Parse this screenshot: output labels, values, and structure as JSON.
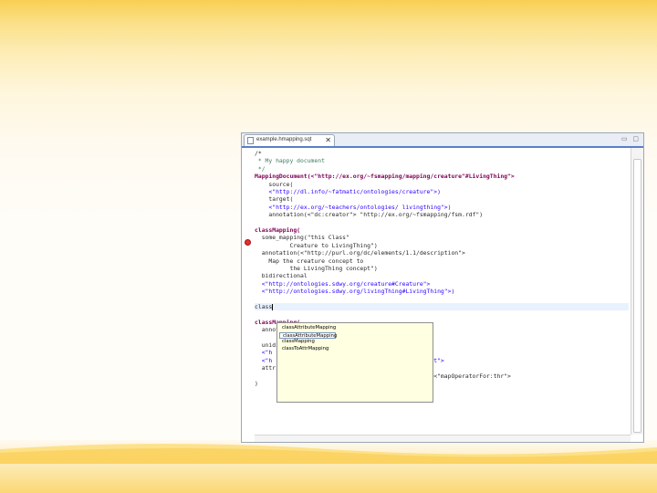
{
  "editor": {
    "tab_title": "example.hmapping.sqt",
    "close_glyph": "✕",
    "window_buttons": "▭ ▢"
  },
  "code_lines": [
    {
      "text": "/*",
      "cls": ""
    },
    {
      "text": " * My happy document",
      "cls": "cm"
    },
    {
      "text": " */",
      "cls": "cm"
    },
    {
      "text": "MappingDocument(<\"http://ex.org/~fsmapping/mapping/creature\"#LivingThing\">",
      "cls": "kw"
    },
    {
      "text": "    source(",
      "cls": ""
    },
    {
      "text": "    <\"http://dl.info/~fatmatic/ontologies/creature\">)",
      "cls": "str"
    },
    {
      "text": "    target(",
      "cls": ""
    },
    {
      "text": "    <\"http://ex.org/~teachers/ontologies/ livingthing\">)",
      "cls": "str"
    },
    {
      "text": "    annotation(<\"dc:creator\"> \"http://ex.org/~fsmapping/fsm.rdf\")",
      "cls": ""
    },
    {
      "text": "",
      "cls": ""
    },
    {
      "text": "classMapping(",
      "cls": "kw"
    },
    {
      "text": "  some_mapping(\"this Class\"",
      "cls": ""
    },
    {
      "text": "          Creature to LivingThing\")",
      "cls": ""
    },
    {
      "text": "  annotation(<\"http://purl.org/dc/elements/1.1/description\">",
      "cls": ""
    },
    {
      "text": "    Map the creature concept to",
      "cls": ""
    },
    {
      "text": "          the LivingThing concept\")",
      "cls": ""
    },
    {
      "text": "  bidirectional",
      "cls": ""
    },
    {
      "text": "  <\"http://ontologies.sdwy.org/creature#Creature\">",
      "cls": "str"
    },
    {
      "text": "  <\"http://ontologies.sdwy.org/livingThing#LivingThing\">)",
      "cls": "str"
    },
    {
      "text": "",
      "cls": ""
    },
    {
      "text": "class",
      "cls": "",
      "current": true
    },
    {
      "text": "",
      "cls": ""
    },
    {
      "text": "classMapping(",
      "cls": "kw"
    },
    {
      "text": "  annotation(",
      "cls": ""
    },
    {
      "text": "",
      "cls": ""
    },
    {
      "text": "  unidirectional",
      "cls": ""
    },
    {
      "text": "  <\"h                                            \">",
      "cls": "str"
    },
    {
      "text": "  <\"h                                            ult\">",
      "cls": "str"
    },
    {
      "text": "  attributeMapping(",
      "cls": ""
    },
    {
      "text": "                                                \"> <\"mapOperatorFor:thr\">",
      "cls": ""
    },
    {
      "text": ")",
      "cls": ""
    }
  ],
  "autocomplete": {
    "items": [
      "classAttributeMapping",
      "classAttributeMapping",
      "classMapping",
      "classToAttrMapping"
    ],
    "selected_index": 1
  }
}
